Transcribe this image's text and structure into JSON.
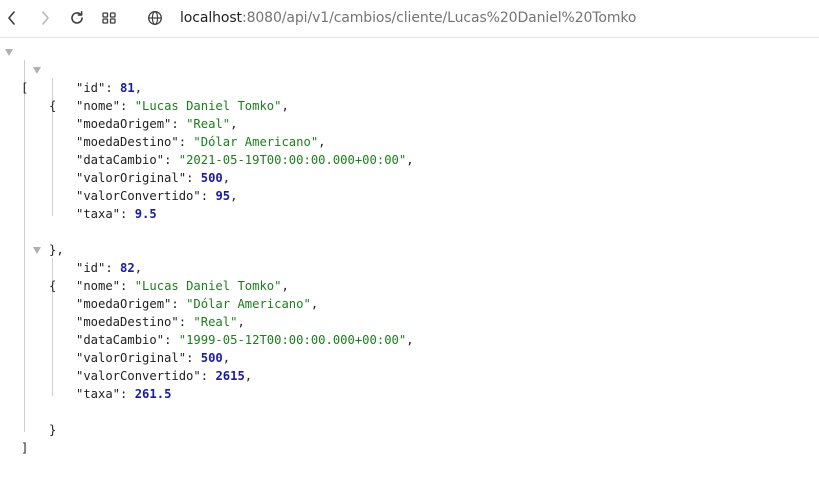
{
  "browser": {
    "url_host": "localhost",
    "url_rest": ":8080/api/v1/cambios/cliente/Lucas%20Daniel%20Tomko"
  },
  "json": {
    "open_bracket": "[",
    "close_bracket": "]",
    "open_brace": "{",
    "close_brace_comma": "},",
    "close_brace": "}",
    "records": [
      {
        "id_key": "\"id\"",
        "id_val": "81",
        "nome_key": "\"nome\"",
        "nome_val": "\"Lucas Daniel Tomko\"",
        "moedaOrigem_key": "\"moedaOrigem\"",
        "moedaOrigem_val": "\"Real\"",
        "moedaDestino_key": "\"moedaDestino\"",
        "moedaDestino_val": "\"Dólar Americano\"",
        "dataCambio_key": "\"dataCambio\"",
        "dataCambio_val": "\"2021-05-19T00:00:00.000+00:00\"",
        "valorOriginal_key": "\"valorOriginal\"",
        "valorOriginal_val": "500",
        "valorConvertido_key": "\"valorConvertido\"",
        "valorConvertido_val": "95",
        "taxa_key": "\"taxa\"",
        "taxa_val": "9.5"
      },
      {
        "id_key": "\"id\"",
        "id_val": "82",
        "nome_key": "\"nome\"",
        "nome_val": "\"Lucas Daniel Tomko\"",
        "moedaOrigem_key": "\"moedaOrigem\"",
        "moedaOrigem_val": "\"Dólar Americano\"",
        "moedaDestino_key": "\"moedaDestino\"",
        "moedaDestino_val": "\"Real\"",
        "dataCambio_key": "\"dataCambio\"",
        "dataCambio_val": "\"1999-05-12T00:00:00.000+00:00\"",
        "valorOriginal_key": "\"valorOriginal\"",
        "valorOriginal_val": "500",
        "valorConvertido_key": "\"valorConvertido\"",
        "valorConvertido_val": "2615",
        "taxa_key": "\"taxa\"",
        "taxa_val": "261.5"
      }
    ]
  }
}
